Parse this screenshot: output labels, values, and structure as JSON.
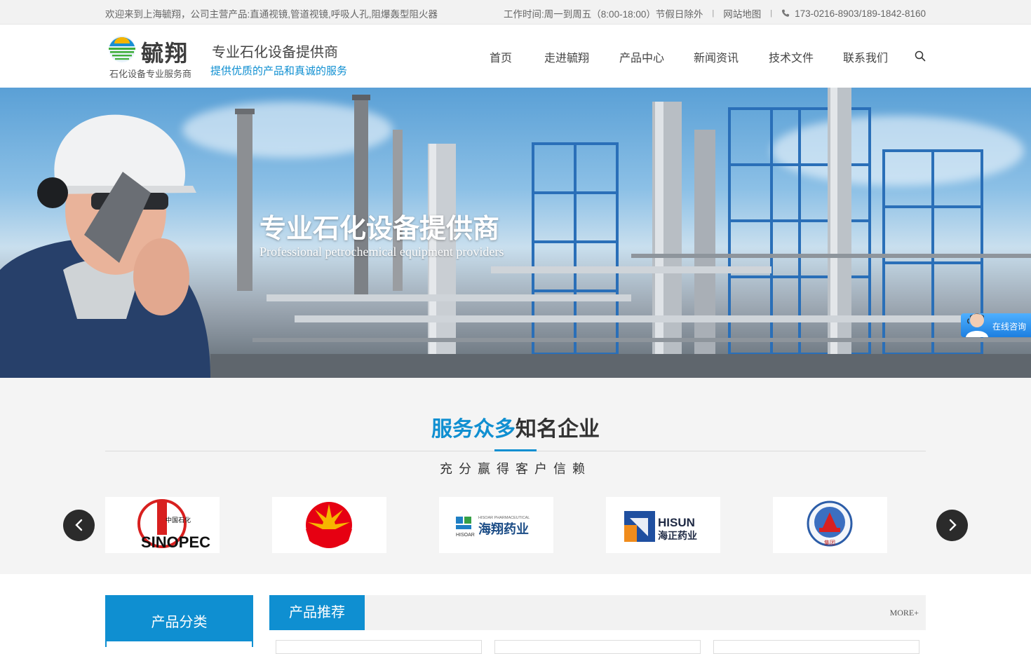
{
  "topbar": {
    "welcome": "欢迎来到上海毓翔，公司主营产品:直通视镜,管道视镜,呼吸人孔,阻爆轰型阻火器",
    "hours": "工作时间:周一到周五（8:00-18:00）节假日除外",
    "sitemap": "网站地图",
    "separator": "|",
    "phone": "173-0216-8903/189-1842-8160"
  },
  "header": {
    "logo_name": "毓翔",
    "logo_sub": "石化设备专业服务商",
    "slogan_main": "专业石化设备提供商",
    "slogan_sub": "提供优质的产品和真诚的服务",
    "nav": [
      "首页",
      "走进毓翔",
      "产品中心",
      "新闻资讯",
      "技术文件",
      "联系我们"
    ]
  },
  "banner": {
    "title": "专业石化设备提供商",
    "subtitle": "Professional petrochemical equipment providers",
    "consult": "在线咨询"
  },
  "clients": {
    "heading_highlight": "服务众多",
    "heading_rest": "知名企业",
    "tagline": "充分赢得客户信赖",
    "logos": [
      {
        "name": "sinopec",
        "text": "SINOPEC",
        "small": "中国石化"
      },
      {
        "name": "petrochina"
      },
      {
        "name": "hisoar",
        "text": "海翔药业",
        "small": "HISOAR PHARMACEUTICAL",
        "tag": "HISOAR"
      },
      {
        "name": "hisun",
        "text": "HISUN",
        "small": "海正药业"
      },
      {
        "name": "group-seal",
        "small": "集团"
      }
    ]
  },
  "products": {
    "category_title": "产品分类",
    "recommend_title": "产品推荐",
    "more": "MORE+"
  },
  "colors": {
    "accent": "#0f8fd1",
    "sinopec_red": "#d8201f",
    "petrochina_red": "#e60012",
    "petrochina_yellow": "#f7b500",
    "hisun_blue": "#1f4fa0"
  }
}
